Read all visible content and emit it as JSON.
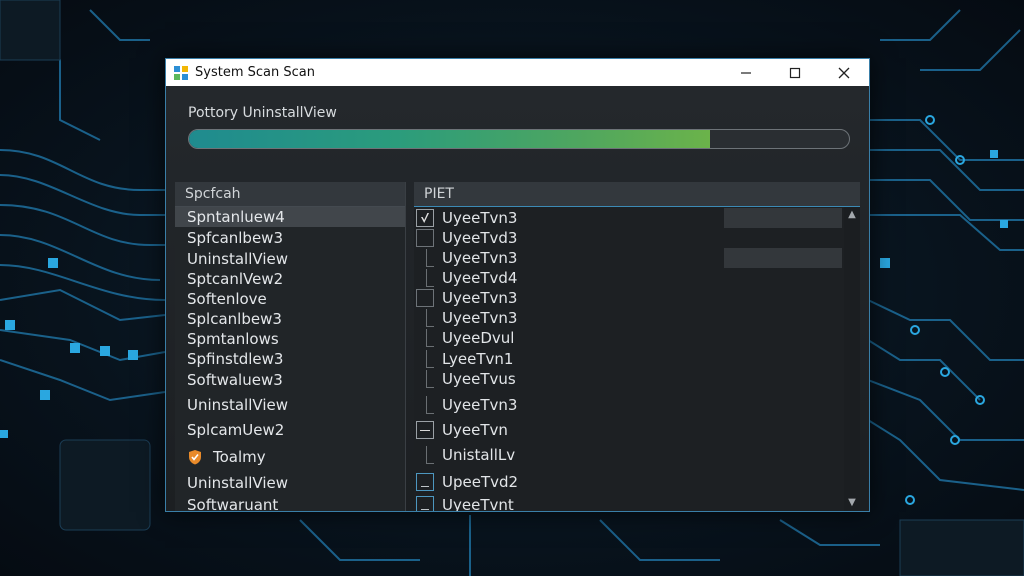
{
  "window": {
    "title": "System Scan Scan",
    "controls": {
      "minimize": "—",
      "maximize": "☐",
      "close": "✕"
    }
  },
  "scan": {
    "label": "Pottory UninstallView",
    "progress_fraction": 0.79
  },
  "left_panel": {
    "header": "Spcfcah",
    "items": [
      {
        "label": "Spntanluew4",
        "selected": true
      },
      {
        "label": "Spfcanlbew3"
      },
      {
        "label": "UninstallView"
      },
      {
        "label": "SptcanlVew2"
      },
      {
        "label": "Softenlove"
      },
      {
        "label": "Splcanlbew3"
      },
      {
        "label": "Spmtanlows"
      },
      {
        "label": "Spfinstdlew3"
      },
      {
        "label": "Softwaluew3"
      },
      {
        "label": "UninstallView"
      },
      {
        "label": "SplcamUew2"
      },
      {
        "label": "Toalmy",
        "icon": "shield-icon"
      },
      {
        "label": "UninstallView"
      },
      {
        "label": "Softwaruant"
      }
    ]
  },
  "right_panel": {
    "header": "PIET",
    "items": [
      {
        "label": "UyeeTvn3",
        "box": "checked"
      },
      {
        "label": "UyeeTvd3",
        "box": "box"
      },
      {
        "label": "UyeeTvn3",
        "box": "tick"
      },
      {
        "label": "UyeeTvd4",
        "box": "tick"
      },
      {
        "label": "UyeeTvn3",
        "box": "box"
      },
      {
        "label": "UyeeTvn3",
        "box": "tick"
      },
      {
        "label": "UyeeDvul",
        "box": "tick"
      },
      {
        "label": "LyeeTvn1",
        "box": "tick"
      },
      {
        "label": "UyeeTvus",
        "box": "tick"
      },
      {
        "label": "UyeeTvn3",
        "box": "tick"
      },
      {
        "label": "UyeeTvn",
        "box": "minus"
      },
      {
        "label": "UnistallLv",
        "box": "tick"
      },
      {
        "label": "UpeeTvd2",
        "box": "blue"
      },
      {
        "label": "UyeeTvnt",
        "box": "blue"
      }
    ],
    "scroll_up": "▲",
    "scroll_down": "▼"
  },
  "colors": {
    "accent": "#3a7fa8",
    "progress_start": "#1f8b8f",
    "progress_end": "#6bb34a",
    "shield": "#e88a2a"
  }
}
